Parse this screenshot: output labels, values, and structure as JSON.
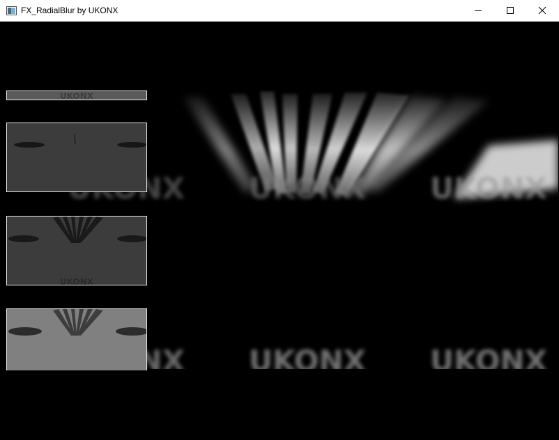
{
  "window": {
    "title": "FX_RadialBlur by UKONX",
    "icons": [
      "app-icon",
      "minimize-icon",
      "maximize-icon",
      "close-icon"
    ]
  },
  "scene": {
    "watermark_text": "UKONX",
    "colors": {
      "background": "#000000",
      "streak": "#ffffff",
      "panel_dark": "#3c3c3c",
      "panel_light": "#808080",
      "panel_border": "#e9e9e9"
    }
  },
  "preview_panels": [
    {
      "name": "preview-panel-1"
    },
    {
      "name": "preview-panel-2"
    },
    {
      "name": "preview-panel-3"
    },
    {
      "name": "preview-panel-4"
    }
  ]
}
